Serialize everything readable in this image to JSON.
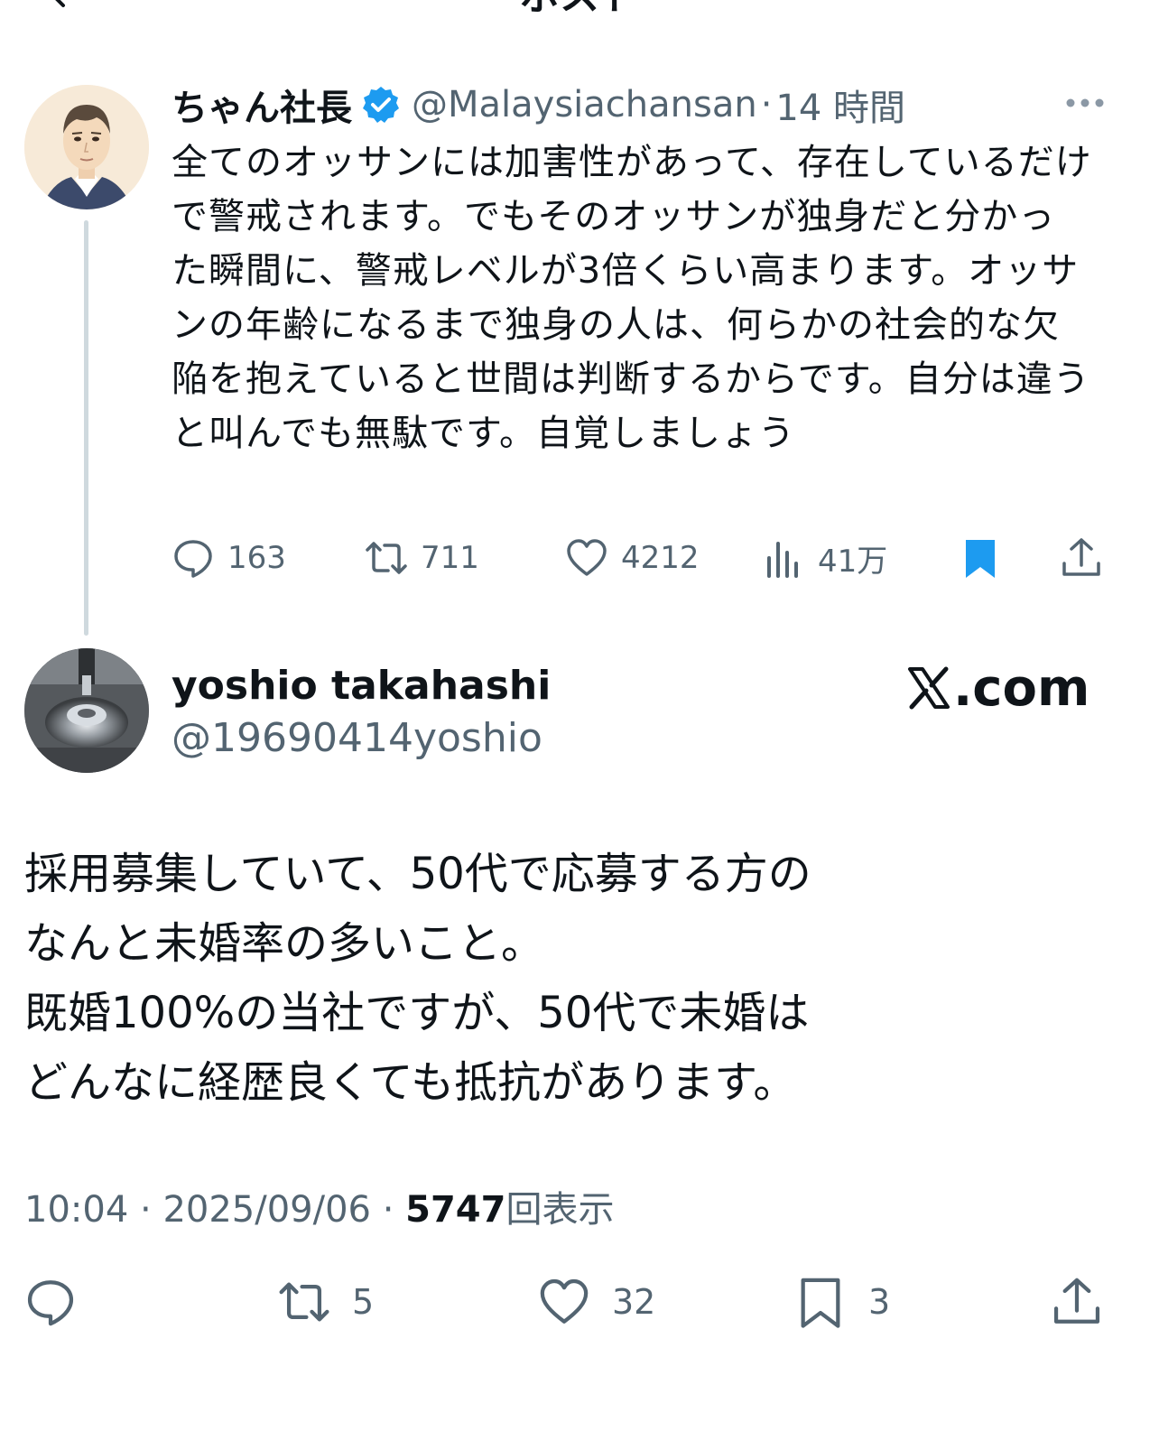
{
  "nav": {
    "title": "ポスト"
  },
  "quoted_tweet": {
    "author_name": "ちゃん社長",
    "handle": "@Malaysiachansan",
    "separator": "·",
    "time": "14 時間",
    "body": "全てのオッサンには加害性があって、存在しているだけで警戒されます。でもそのオッサンが独身だと分かった瞬間に、警戒レベルが3倍くらい高まります。オッサンの年齢になるまで独身の人は、何らかの社会的な欠陥を抱えていると世間は判断するからです。自分は違うと叫んでも無駄です。自覚しましょう",
    "replies": "163",
    "reposts": "711",
    "likes": "4212",
    "views": "41万",
    "bookmarked": true,
    "verified": true,
    "accent_color": "#1d9bf0"
  },
  "main_tweet": {
    "author_name": "yoshio takahashi",
    "handle": "@19690414yoshio",
    "source_logo": ".com",
    "body_lines": [
      "採用募集していて、50代で応募する方の",
      "なんと未婚率の多いこと。",
      "既婚100%の当社ですが、50代で未婚は",
      "どんなに経歴良くても抵抗があります。"
    ],
    "time": "10:04",
    "date": "2025/09/06",
    "separator": "·",
    "views": "5747",
    "views_label": "回表示",
    "reposts": "5",
    "likes": "32",
    "bookmarks": "3"
  },
  "colors": {
    "text": "#0f1419",
    "secondary": "#536471",
    "thread_line": "#cfd9de",
    "accent": "#1d9bf0"
  }
}
